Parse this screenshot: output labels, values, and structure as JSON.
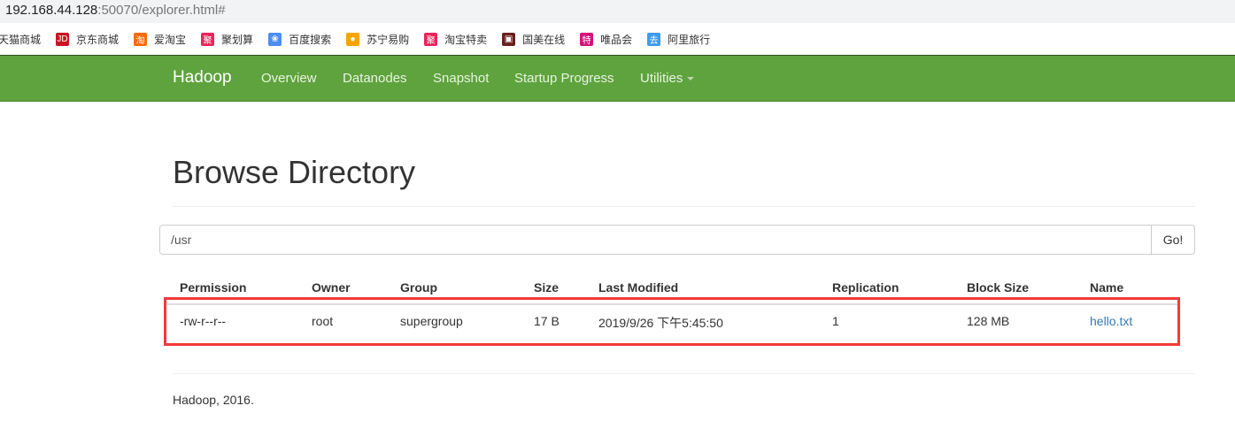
{
  "browser": {
    "url_host": "192.168.44.128",
    "url_rest": ":50070/explorer.html#"
  },
  "bookmarks": [
    {
      "label": "天猫商城",
      "icon": "tmall-icon",
      "color": ""
    },
    {
      "label": "京东商城",
      "icon": "jd-icon",
      "color": "#c81623",
      "glyph": "JD"
    },
    {
      "label": "爱淘宝",
      "icon": "aitaobao-icon",
      "color": "#ff6a00",
      "glyph": "淘"
    },
    {
      "label": "聚划算",
      "icon": "juhuasuan-icon",
      "color": "#e8265b",
      "glyph": "聚"
    },
    {
      "label": "百度搜索",
      "icon": "baidu-paw-icon",
      "color": "#4e8df5",
      "glyph": "❀"
    },
    {
      "label": "苏宁易购",
      "icon": "suning-icon",
      "color": "#f8a400",
      "glyph": "●"
    },
    {
      "label": "淘宝特卖",
      "icon": "taobao-temai-icon",
      "color": "#e8265b",
      "glyph": "聚"
    },
    {
      "label": "国美在线",
      "icon": "gome-icon",
      "color": "#6b1f1f",
      "glyph": "▣"
    },
    {
      "label": "唯品会",
      "icon": "vip-icon",
      "color": "#d6127a",
      "glyph": "特"
    },
    {
      "label": "阿里旅行",
      "icon": "alitrip-icon",
      "color": "#3d9cf0",
      "glyph": "去"
    }
  ],
  "navbar": {
    "brand": "Hadoop",
    "items": [
      "Overview",
      "Datanodes",
      "Snapshot",
      "Startup Progress",
      "Utilities"
    ],
    "color": "#5fa33e"
  },
  "page": {
    "title": "Browse Directory",
    "path": "/usr",
    "go_label": "Go!"
  },
  "table": {
    "headers": [
      "Permission",
      "Owner",
      "Group",
      "Size",
      "Last Modified",
      "Replication",
      "Block Size",
      "Name"
    ],
    "rows": [
      [
        "-rw-r--r--",
        "root",
        "supergroup",
        "17 B",
        "2019/9/26 下午5:45:50",
        "1",
        "128 MB",
        "hello.txt"
      ]
    ]
  },
  "footer": "Hadoop, 2016."
}
